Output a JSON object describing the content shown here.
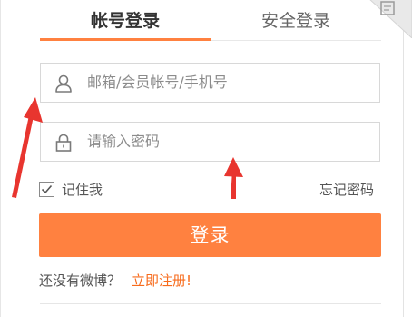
{
  "tabs": {
    "account_login": "帐号登录",
    "secure_login": "安全登录"
  },
  "form": {
    "username_placeholder": "邮箱/会员帐号/手机号",
    "password_placeholder": "请输入密码",
    "remember_me": "记住我",
    "remember_checked": true,
    "forgot_password": "忘记密码",
    "login_button": "登录"
  },
  "register": {
    "prompt": "还没有微博？",
    "link": "立即注册!"
  },
  "colors": {
    "accent": "#ff8140",
    "link": "#f76b1c",
    "annotation_arrow": "#e8352f"
  },
  "icons": {
    "qr_corner": "qr-code-icon",
    "username": "user-icon",
    "password": "lock-icon",
    "remember": "checkbox-checked-icon"
  }
}
